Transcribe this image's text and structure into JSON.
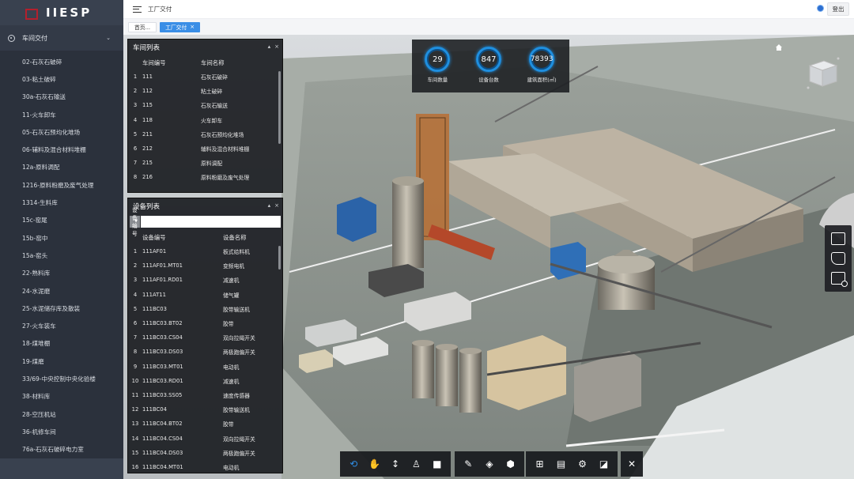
{
  "app": {
    "logo_text": "IIESP"
  },
  "topbar": {
    "breadcrumb": "工厂交付",
    "logout_label": "登出"
  },
  "tabs": [
    {
      "label": "首页..."
    },
    {
      "label": "工厂交付",
      "close": "×"
    }
  ],
  "sidebar": {
    "group_label": "车间交付",
    "items": [
      "02-石灰石破碎",
      "03-粘土破碎",
      "30a-石灰石输送",
      "11-火车卸车",
      "05-石灰石预均化堆场",
      "06-辅料及混合材料堆棚",
      "12a-原料调配",
      "1216-原料粉磨及废气处理",
      "1314-生料库",
      "15c-窑尾",
      "15b-窑中",
      "15a-窑头",
      "22-熟料库",
      "24-水泥磨",
      "25-水泥储存库及散装",
      "27-火车装车",
      "18-煤堆棚",
      "19-煤磨",
      "33/69-中央控制中央化验楼",
      "38-材料库",
      "28-空压机站",
      "36-机修车间",
      "76a-石灰石破碎电力室"
    ]
  },
  "workshop_panel": {
    "title": "车间列表",
    "columns": [
      "车间编号",
      "车间名称"
    ],
    "rows": [
      [
        "1",
        "111",
        "石灰石破碎"
      ],
      [
        "2",
        "112",
        "粘土破碎"
      ],
      [
        "3",
        "115",
        "石灰石输送"
      ],
      [
        "4",
        "118",
        "火车卸车"
      ],
      [
        "5",
        "211",
        "石灰石预均化堆场"
      ],
      [
        "6",
        "212",
        "辅料及混合材料堆棚"
      ],
      [
        "7",
        "215",
        "原料调配"
      ],
      [
        "8",
        "216",
        "原料粉磨及废气处理"
      ]
    ]
  },
  "equipment_panel": {
    "title": "设备列表",
    "search_field": "设备编号",
    "columns": [
      "设备编号",
      "设备名称"
    ],
    "rows": [
      [
        "1",
        "111AF01",
        "板式给料机"
      ],
      [
        "2",
        "111AF01.MT01",
        "变频电机"
      ],
      [
        "3",
        "111AF01.RD01",
        "减速机"
      ],
      [
        "4",
        "111AT11",
        "储气罐"
      ],
      [
        "5",
        "111BC03",
        "胶带输送机"
      ],
      [
        "6",
        "111BC03.BT02",
        "胶带"
      ],
      [
        "7",
        "111BC03.CS04",
        "双向拉绳开关"
      ],
      [
        "8",
        "111BC03.DS03",
        "两极跑偏开关"
      ],
      [
        "9",
        "111BC03.MT01",
        "电动机"
      ],
      [
        "10",
        "111BC03.RD01",
        "减速机"
      ],
      [
        "11",
        "111BC03.SS05",
        "速度传感器"
      ],
      [
        "12",
        "111BC04",
        "胶带输送机"
      ],
      [
        "13",
        "111BC04.BT02",
        "胶带"
      ],
      [
        "14",
        "111BC04.CS04",
        "双向拉绳开关"
      ],
      [
        "15",
        "111BC04.DS03",
        "两极跑偏开关"
      ],
      [
        "16",
        "111BC04.MT01",
        "电动机"
      ]
    ]
  },
  "stats": [
    {
      "value": "29",
      "label": "车间数量"
    },
    {
      "value": "847",
      "label": "设备台数"
    },
    {
      "value": "78393",
      "label": "建筑面积(㎡)"
    }
  ],
  "panel_controls": {
    "collapse": "▴",
    "close": "×"
  },
  "toolbar_close": "✕",
  "colors": {
    "sidebar": "#39414f",
    "accent": "#3a8ee6",
    "brand": "#b3202d"
  }
}
